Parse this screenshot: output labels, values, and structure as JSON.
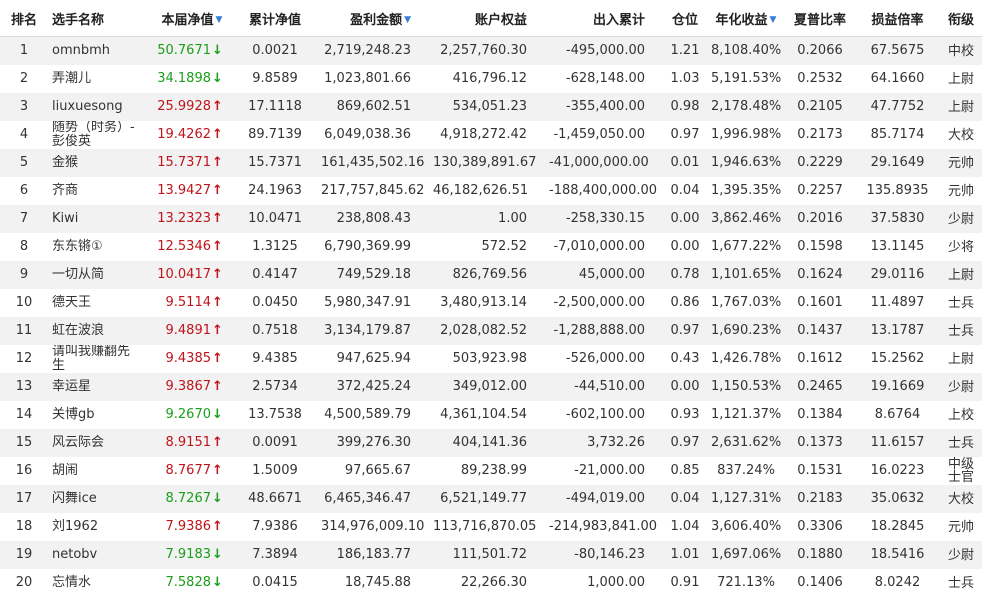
{
  "headers": [
    {
      "key": "rank",
      "label": "排名",
      "sortable": false
    },
    {
      "key": "name",
      "label": "选手名称",
      "sortable": false
    },
    {
      "key": "nav",
      "label": "本届净值",
      "sortable": true
    },
    {
      "key": "cum_nav",
      "label": "累计净值",
      "sortable": false
    },
    {
      "key": "profit",
      "label": "盈利金额",
      "sortable": true
    },
    {
      "key": "equity",
      "label": "账户权益",
      "sortable": false
    },
    {
      "key": "inout",
      "label": "出入累计",
      "sortable": false
    },
    {
      "key": "position",
      "label": "仓位",
      "sortable": false
    },
    {
      "key": "annual",
      "label": "年化收益",
      "sortable": true
    },
    {
      "key": "sharpe",
      "label": "夏普比率",
      "sortable": false
    },
    {
      "key": "pl_ratio",
      "label": "损益倍率",
      "sortable": false
    },
    {
      "key": "level",
      "label": "衔级",
      "sortable": false
    }
  ],
  "sort_icon": "▼",
  "colors": {
    "up": "#c0141b",
    "down": "#1a9e1a",
    "sort_icon": "#3a7bd5"
  },
  "arrows": {
    "up": "🡅",
    "down": "🡇"
  },
  "rows": [
    {
      "rank": "1",
      "name": "omnbmh",
      "nav": "50.7671",
      "trend": "down",
      "cum_nav": "0.0021",
      "profit": "2,719,248.23",
      "equity": "2,257,760.30",
      "inout": "-495,000.00",
      "position": "1.21",
      "annual": "8,108.40%",
      "sharpe": "0.2066",
      "pl_ratio": "67.5675",
      "level": "中校"
    },
    {
      "rank": "2",
      "name": "弄潮儿",
      "nav": "34.1898",
      "trend": "down",
      "cum_nav": "9.8589",
      "profit": "1,023,801.66",
      "equity": "416,796.12",
      "inout": "-628,148.00",
      "position": "1.03",
      "annual": "5,191.53%",
      "sharpe": "0.2532",
      "pl_ratio": "64.1660",
      "level": "上尉"
    },
    {
      "rank": "3",
      "name": "liuxuesong",
      "nav": "25.9928",
      "trend": "up",
      "cum_nav": "17.1118",
      "profit": "869,602.51",
      "equity": "534,051.23",
      "inout": "-355,400.00",
      "position": "0.98",
      "annual": "2,178.48%",
      "sharpe": "0.2105",
      "pl_ratio": "47.7752",
      "level": "上尉"
    },
    {
      "rank": "4",
      "name": "随势（时务）-彭俊英",
      "nav": "19.4262",
      "trend": "up",
      "cum_nav": "89.7139",
      "profit": "6,049,038.36",
      "equity": "4,918,272.42",
      "inout": "-1,459,050.00",
      "position": "0.97",
      "annual": "1,996.98%",
      "sharpe": "0.2173",
      "pl_ratio": "85.7174",
      "level": "大校"
    },
    {
      "rank": "5",
      "name": "金猴",
      "nav": "15.7371",
      "trend": "up",
      "cum_nav": "15.7371",
      "profit": "161,435,502.16",
      "equity": "130,389,891.67",
      "inout": "-41,000,000.00",
      "position": "0.01",
      "annual": "1,946.63%",
      "sharpe": "0.2229",
      "pl_ratio": "29.1649",
      "level": "元帅"
    },
    {
      "rank": "6",
      "name": "齐商",
      "nav": "13.9427",
      "trend": "up",
      "cum_nav": "24.1963",
      "profit": "217,757,845.62",
      "equity": "46,182,626.51",
      "inout": "-188,400,000.00",
      "position": "0.04",
      "annual": "1,395.35%",
      "sharpe": "0.2257",
      "pl_ratio": "135.8935",
      "level": "元帅"
    },
    {
      "rank": "7",
      "name": "Kiwi",
      "nav": "13.2323",
      "trend": "up",
      "cum_nav": "10.0471",
      "profit": "238,808.43",
      "equity": "1.00",
      "inout": "-258,330.15",
      "position": "0.00",
      "annual": "3,862.46%",
      "sharpe": "0.2016",
      "pl_ratio": "37.5830",
      "level": "少尉"
    },
    {
      "rank": "8",
      "name": "东东锵①",
      "nav": "12.5346",
      "trend": "up",
      "cum_nav": "1.3125",
      "profit": "6,790,369.99",
      "equity": "572.52",
      "inout": "-7,010,000.00",
      "position": "0.00",
      "annual": "1,677.22%",
      "sharpe": "0.1598",
      "pl_ratio": "13.1145",
      "level": "少将"
    },
    {
      "rank": "9",
      "name": "一切从简",
      "nav": "10.0417",
      "trend": "up",
      "cum_nav": "0.4147",
      "profit": "749,529.18",
      "equity": "826,769.56",
      "inout": "45,000.00",
      "position": "0.78",
      "annual": "1,101.65%",
      "sharpe": "0.1624",
      "pl_ratio": "29.0116",
      "level": "上尉"
    },
    {
      "rank": "10",
      "name": "德天王",
      "nav": "9.5114",
      "trend": "up",
      "cum_nav": "0.0450",
      "profit": "5,980,347.91",
      "equity": "3,480,913.14",
      "inout": "-2,500,000.00",
      "position": "0.86",
      "annual": "1,767.03%",
      "sharpe": "0.1601",
      "pl_ratio": "11.4897",
      "level": "士兵"
    },
    {
      "rank": "11",
      "name": "虹在波浪",
      "nav": "9.4891",
      "trend": "up",
      "cum_nav": "0.7518",
      "profit": "3,134,179.87",
      "equity": "2,028,082.52",
      "inout": "-1,288,888.00",
      "position": "0.97",
      "annual": "1,690.23%",
      "sharpe": "0.1437",
      "pl_ratio": "13.1787",
      "level": "士兵"
    },
    {
      "rank": "12",
      "name": "请叫我赚翻先生",
      "nav": "9.4385",
      "trend": "up",
      "cum_nav": "9.4385",
      "profit": "947,625.94",
      "equity": "503,923.98",
      "inout": "-526,000.00",
      "position": "0.43",
      "annual": "1,426.78%",
      "sharpe": "0.1612",
      "pl_ratio": "15.2562",
      "level": "上尉"
    },
    {
      "rank": "13",
      "name": "幸运星",
      "nav": "9.3867",
      "trend": "up",
      "cum_nav": "2.5734",
      "profit": "372,425.24",
      "equity": "349,012.00",
      "inout": "-44,510.00",
      "position": "0.00",
      "annual": "1,150.53%",
      "sharpe": "0.2465",
      "pl_ratio": "19.1669",
      "level": "少尉"
    },
    {
      "rank": "14",
      "name": "关博gb",
      "nav": "9.2670",
      "trend": "down",
      "cum_nav": "13.7538",
      "profit": "4,500,589.79",
      "equity": "4,361,104.54",
      "inout": "-602,100.00",
      "position": "0.93",
      "annual": "1,121.37%",
      "sharpe": "0.1384",
      "pl_ratio": "8.6764",
      "level": "上校"
    },
    {
      "rank": "15",
      "name": "风云际会",
      "nav": "8.9151",
      "trend": "up",
      "cum_nav": "0.0091",
      "profit": "399,276.30",
      "equity": "404,141.36",
      "inout": "3,732.26",
      "position": "0.97",
      "annual": "2,631.62%",
      "sharpe": "0.1373",
      "pl_ratio": "11.6157",
      "level": "士兵"
    },
    {
      "rank": "16",
      "name": "胡闹",
      "nav": "8.7677",
      "trend": "up",
      "cum_nav": "1.5009",
      "profit": "97,665.67",
      "equity": "89,238.99",
      "inout": "-21,000.00",
      "position": "0.85",
      "annual": "837.24%",
      "sharpe": "0.1531",
      "pl_ratio": "16.0223",
      "level": "中级士官"
    },
    {
      "rank": "17",
      "name": "闪舞ice",
      "nav": "8.7267",
      "trend": "down",
      "cum_nav": "48.6671",
      "profit": "6,465,346.47",
      "equity": "6,521,149.77",
      "inout": "-494,019.00",
      "position": "0.04",
      "annual": "1,127.31%",
      "sharpe": "0.2183",
      "pl_ratio": "35.0632",
      "level": "大校"
    },
    {
      "rank": "18",
      "name": "刘1962",
      "nav": "7.9386",
      "trend": "up",
      "cum_nav": "7.9386",
      "profit": "314,976,009.10",
      "equity": "113,716,870.05",
      "inout": "-214,983,841.00",
      "position": "1.04",
      "annual": "3,606.40%",
      "sharpe": "0.3306",
      "pl_ratio": "18.2845",
      "level": "元帅"
    },
    {
      "rank": "19",
      "name": "netobv",
      "nav": "7.9183",
      "trend": "down",
      "cum_nav": "7.3894",
      "profit": "186,183.77",
      "equity": "111,501.72",
      "inout": "-80,146.23",
      "position": "1.01",
      "annual": "1,697.06%",
      "sharpe": "0.1880",
      "pl_ratio": "18.5416",
      "level": "少尉"
    },
    {
      "rank": "20",
      "name": "忘情水",
      "nav": "7.5828",
      "trend": "down",
      "cum_nav": "0.0415",
      "profit": "18,745.88",
      "equity": "22,266.30",
      "inout": "1,000.00",
      "position": "0.91",
      "annual": "721.13%",
      "sharpe": "0.1406",
      "pl_ratio": "8.0242",
      "level": "士兵"
    }
  ]
}
